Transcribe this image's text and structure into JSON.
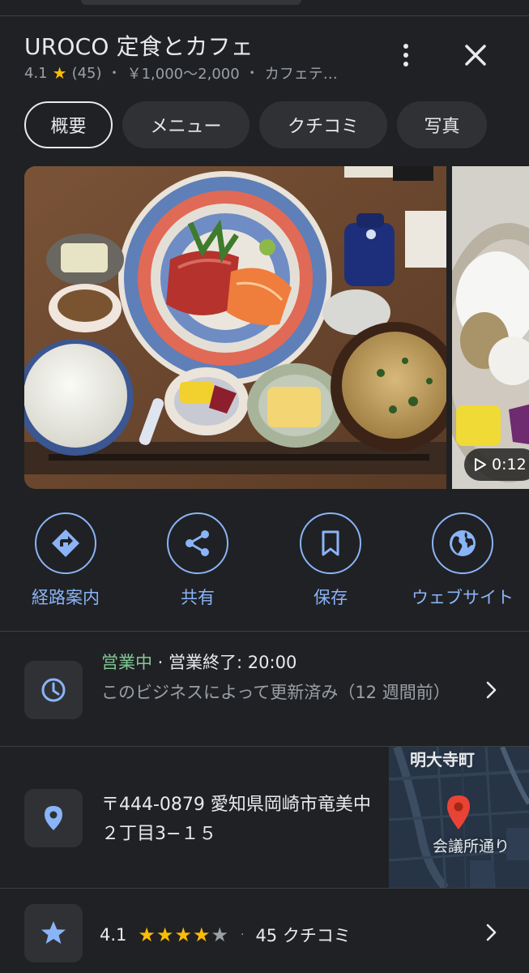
{
  "place": {
    "name": "UROCO 定食とカフェ",
    "rating": "4.1",
    "review_count": "(45)",
    "price": "￥1,000〜2,000",
    "category": "カフェテ…"
  },
  "tabs": [
    {
      "label": "概要",
      "active": true
    },
    {
      "label": "メニュー",
      "active": false
    },
    {
      "label": "クチコミ",
      "active": false
    },
    {
      "label": "写真",
      "active": false
    }
  ],
  "photos": {
    "video_duration": "0:12",
    "play_icon": "play-icon"
  },
  "actions": [
    {
      "label": "経路案内",
      "icon": "directions-icon"
    },
    {
      "label": "共有",
      "icon": "share-icon"
    },
    {
      "label": "保存",
      "icon": "bookmark-icon"
    },
    {
      "label": "ウェブサイト",
      "icon": "globe-icon"
    }
  ],
  "hours": {
    "status": "営業中",
    "separator": " · ",
    "closing": "営業終了: 20:00",
    "note": "このビジネスによって更新済み（12 週間前）"
  },
  "address": {
    "text": "〒444-0879 愛知県岡崎市竜美中２丁目3−１５",
    "map_label_top": "明大寺町",
    "map_label_bottom": "会議所通り"
  },
  "reviews_summary": {
    "rating": "4.1",
    "stars_filled": 4,
    "stars_total": 5,
    "separator": "·",
    "count_label": "45 クチコミ"
  },
  "colors": {
    "background": "#202124",
    "accent_blue": "#8ab4f8",
    "open_green": "#81c995",
    "star_yellow": "#fbbc04",
    "map_pin_red": "#ea4335"
  }
}
